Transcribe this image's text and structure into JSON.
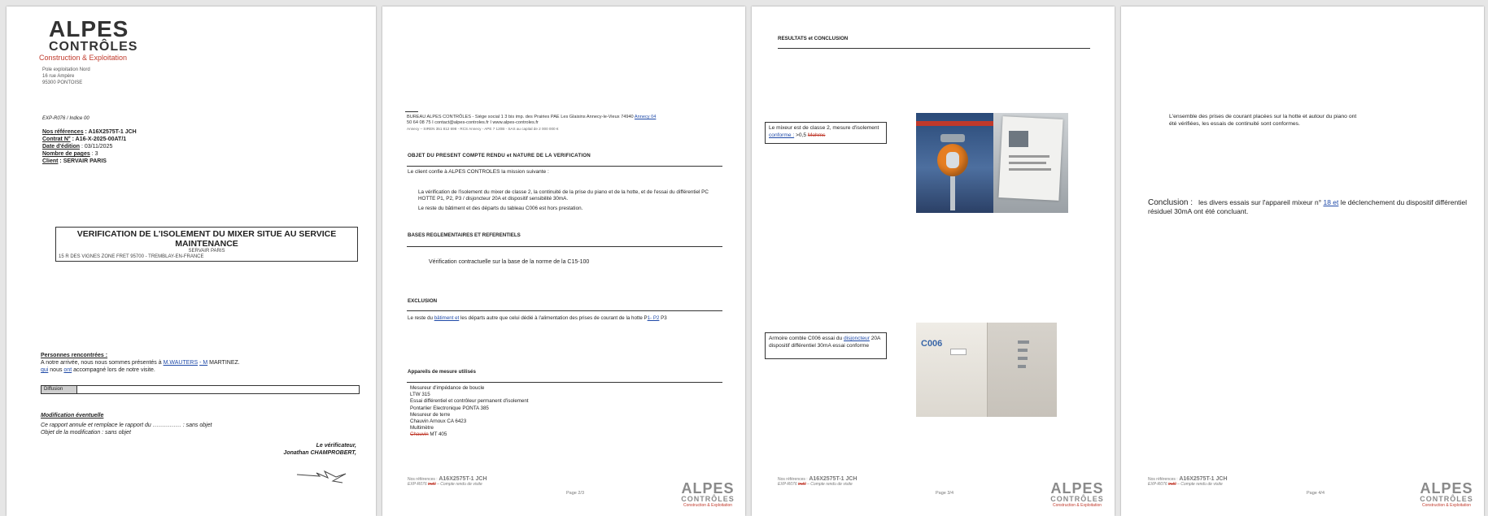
{
  "p1": {
    "logo": {
      "brand": "ALPES",
      "brand2": "CONTRÔLES",
      "tagline": "Construction & Exploitation"
    },
    "address": [
      "Pole exploitation Nord",
      "16 rue Ampère",
      "95300 PONTOISE"
    ],
    "form_ref": "EXP-R076 / Indice 00",
    "refs": {
      "ours_label": "Nos références",
      "ours": "A16X2575T-1 JCH",
      "contract_label": "Contrat N°",
      "contract": "A16-X-2025-00AT/1",
      "date_label": "Date d'édition",
      "date": "03/11/2025",
      "pages_label": "Nombre de pages",
      "pages": "3",
      "client_label": "Client",
      "client": "SERVAIR PARIS"
    },
    "title_box": {
      "title": "VERIFICATION DE L'ISOLEMENT DU MIXER SITUE AU SERVICE MAINTENANCE",
      "sub1": "SERVAIR PARIS",
      "sub2": "15 R DES VIGNES ZONE FRET  95700 - TREMBLAY-EN-FRANCE"
    },
    "met": {
      "heading": "Personnes rencontrées :",
      "line1_a": "A notre arrivée, nous nous sommes présentés à ",
      "line1_link": "M.WAUTERS",
      "line1_b": " ",
      "line1_strike": "- M",
      "line1_c": " MARTINEZ.",
      "line2_a": "qui",
      "line2_b": " nous ",
      "line2_c": "ont",
      "line2_d": " accompagné lors de notre visite."
    },
    "diffusion": "Diffusion",
    "modif": {
      "heading": "Modification éventuelle",
      "line1": "Ce rapport annule et remplace le rapport du …………… : sans objet",
      "line2": "Objet de la modification : sans objet"
    },
    "verifier": {
      "label": "Le vérificateur,",
      "name": "Jonathan CHAMPROBERT,"
    }
  },
  "p2": {
    "header1_a": "BUREAU ALPES CONTRÔLES - Siège social 1 3 bis imp. des Prairies PAE Les Glaisins Annecy-le-Vieux 74940 ",
    "header1_link": "Annecy 04",
    "header2": "50 64 08 75 I contact@alpes-controles.fr I www.alpes-controles.fr",
    "header3": "Annecy – SIREN 351 812 698 - RCS Annecy - APE 7 120B - SAS au capital de 2 000 000 €",
    "s1_title": "OBJET DU PRESENT COMPTE RENDU et NATURE DE LA VERIFICATION",
    "s1_intro": "Le client confie à ALPES CONTROLES la mission suivante :",
    "s1_p1": "La vérification de l'isolement du mixer de classe 2, la continuité de la prise du piano et de la hotte, et de l'essai du différentiel PC HOTTE P1, P2, P3 / disjoncteur 20A et dispositif sensibilité 30mA.",
    "s1_p2": "Le reste du bâtiment et des départs du tableau C006 est hors prestation.",
    "s2_title": "BASES REGLEMENTAIRES ET REFERENTIELS",
    "s2_text": "Vérification contractuelle sur la base de la norme de la C15-100",
    "s3_title": "EXCLUSION",
    "s3_a": "Le reste du ",
    "s3_link": "bâtiment et",
    "s3_b": " les départs autre que celui dédié à l'alimentation des prises de courant de la hotte P",
    "s3_link2": "1- P2",
    "s3_c": " P3",
    "s4_title": "Appareils de mesure utilisés",
    "s4_lines": [
      "Mesureur d'impédance de boucle",
      "LTW 315",
      "Essai différentiel et contrôleur permanent d'isolement",
      "Pontarlier Electronique PONTA 385",
      "Mesureur de terre",
      "Chauvin Arnoux CA 6423",
      "Multimètre"
    ],
    "s4_last_strike": "Chauvin",
    "s4_last": " MT 405",
    "footer_ref_label": "Nos références :",
    "footer_ref": "A16X2575T-1 JCH",
    "footer_form_a": "EXP-R076 ",
    "footer_form_strike": "Ind0",
    "footer_form_b": " – Compte rendu de visite",
    "page_num": "Page 2/3"
  },
  "p3": {
    "section_title": "RESULTATS et CONCLUSION",
    "box1_a": "Le mixeur est de classe 2, mesure d'isolement ",
    "box1_link": "conforme :",
    "box1_b": " >0,5 ",
    "box1_strike": "Mohms",
    "box2_a": "Armoire comble C006 essai du ",
    "box2_link": "disjoncteur",
    "box2_b": " 20A dispositif différentiel 30mA essai conforme",
    "cabinet_label": "C006",
    "footer_ref_label": "Nos références :",
    "footer_ref": "A16X2575T-1 JCH",
    "footer_form_a": "EXP-R076 ",
    "footer_form_strike": "Ind0",
    "footer_form_b": " – Compte rendu de visite",
    "page_num": "Page 3/4"
  },
  "p4": {
    "intro": "L'ensemble des prises de courant placées sur la hotte et autour du piano ont été vérifiées, les essais de continuité sont conformes.",
    "conclusion_label": "Conclusion :",
    "conclusion_a": "les divers essais sur l'appareil mixeur n° ",
    "conclusion_link": "18 et",
    "conclusion_b": " le déclenchement du dispositif différentiel résiduel 30mA ont été concluant.",
    "footer_ref_label": "Nos références :",
    "footer_ref": "A16X2575T-1 JCH",
    "footer_form_a": "EXP-R076 ",
    "footer_form_strike": "Ind0",
    "footer_form_b": " – Compte rendu de visite",
    "page_num": "Page 4/4"
  },
  "footer_logo": {
    "brand": "ALPES",
    "brand2": "CONTRÔLES",
    "tagline": "Construction & Exploitation"
  }
}
